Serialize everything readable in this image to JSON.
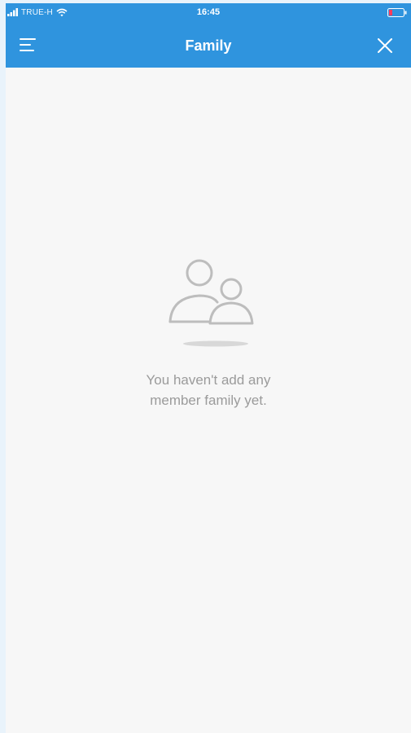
{
  "status_bar": {
    "carrier": "TRUE-H",
    "time": "16:45",
    "signal_icon": "signal-bars-icon",
    "wifi_icon": "wifi-icon",
    "battery_icon": "battery-low-icon"
  },
  "nav": {
    "title": "Family",
    "menu_icon": "hamburger-menu-icon",
    "close_icon": "close-icon"
  },
  "empty_state": {
    "icon": "family-members-icon",
    "message_line1": "You haven't add any",
    "message_line2": "member family yet."
  },
  "colors": {
    "header": "#2f94de",
    "background": "#f7f7f7",
    "icon_gray": "#bdbdbd",
    "message_text": "#9b9b9b",
    "battery_low": "#ff3b5c"
  }
}
